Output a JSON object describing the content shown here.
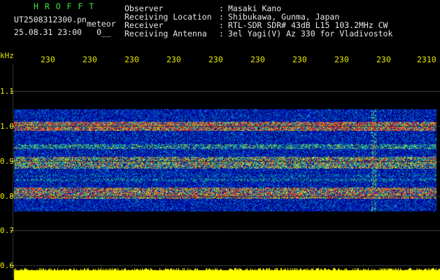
{
  "header": {
    "logo": "H R O F F T",
    "filename": "UT2508312300.pn",
    "meteor_label": "meteor",
    "datetime": "25.08.31 23:00",
    "count": "0__",
    "labels": [
      "Observer",
      "Receiving Location",
      "Receiver",
      "Receiving Antenna"
    ],
    "colons": [
      ":",
      ":",
      ":",
      ":"
    ],
    "values": [
      "Masaki Kano",
      "Shibukawa, Gunma, Japan",
      "RTL-SDR SDR# 43dB L15 103.2MHz CW",
      "3el Yagi(V) Az 330 for Vladivostok"
    ]
  },
  "axis": {
    "y_unit": "kHz",
    "y_ticks": [
      "1.1",
      "1.0",
      "0.9",
      "0.8",
      "0.7",
      "0.6"
    ],
    "x_ticks": [
      "230",
      "230",
      "230",
      "230",
      "230",
      "230",
      "230",
      "230",
      "230",
      "2310"
    ]
  },
  "colors": {
    "background": "#000000",
    "axis_text": "#e6e600",
    "header_values": "#e8e8e8",
    "logo": "#39e839",
    "noise_band_low": "#0a1e8c",
    "noise_band_high": "#ff2020",
    "baseline_fill": "#ffff00"
  }
}
